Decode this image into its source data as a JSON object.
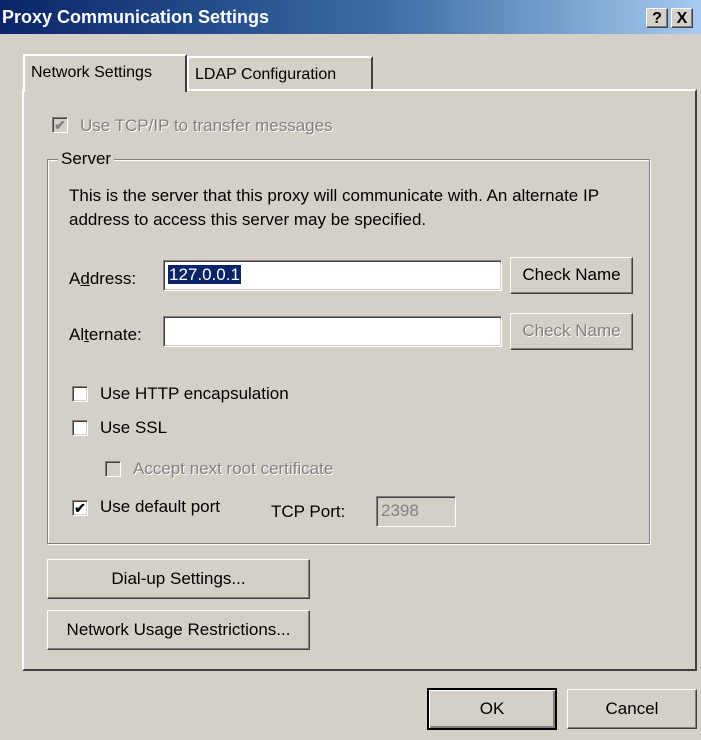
{
  "window": {
    "title": "Proxy Communication Settings",
    "help_btn": "?",
    "close_btn": "X"
  },
  "tabs": [
    {
      "label": "Network Settings"
    },
    {
      "label": "LDAP Configuration"
    }
  ],
  "use_tcp": {
    "label": "Use TCP/IP to transfer messages",
    "checked": true,
    "disabled": true
  },
  "server": {
    "legend": "Server",
    "description_line1": "This is the server that this proxy will communicate with. An alternate IP",
    "description_line2": "address to access this server may be specified.",
    "address_label_pre": "A",
    "address_label_u": "d",
    "address_label_post": "dress:",
    "address_value": "127.0.0.1",
    "check_name": "Check Name",
    "alternate_label_pre": "Al",
    "alternate_label_u": "t",
    "alternate_label_post": "ernate:",
    "alternate_value": "",
    "check_name_alt": "Check Name",
    "http_encap": "Use HTTP encapsulation",
    "use_ssl": "Use SSL",
    "accept_root": "Accept next root certificate",
    "default_port": "Use default port",
    "tcp_port_label": "TCP Port:",
    "tcp_port_value": "2398"
  },
  "buttons": {
    "dialup": "Dial-up Settings...",
    "usage": "Network Usage Restrictions...",
    "ok": "OK",
    "cancel": "Cancel"
  },
  "checkmark": "✔"
}
